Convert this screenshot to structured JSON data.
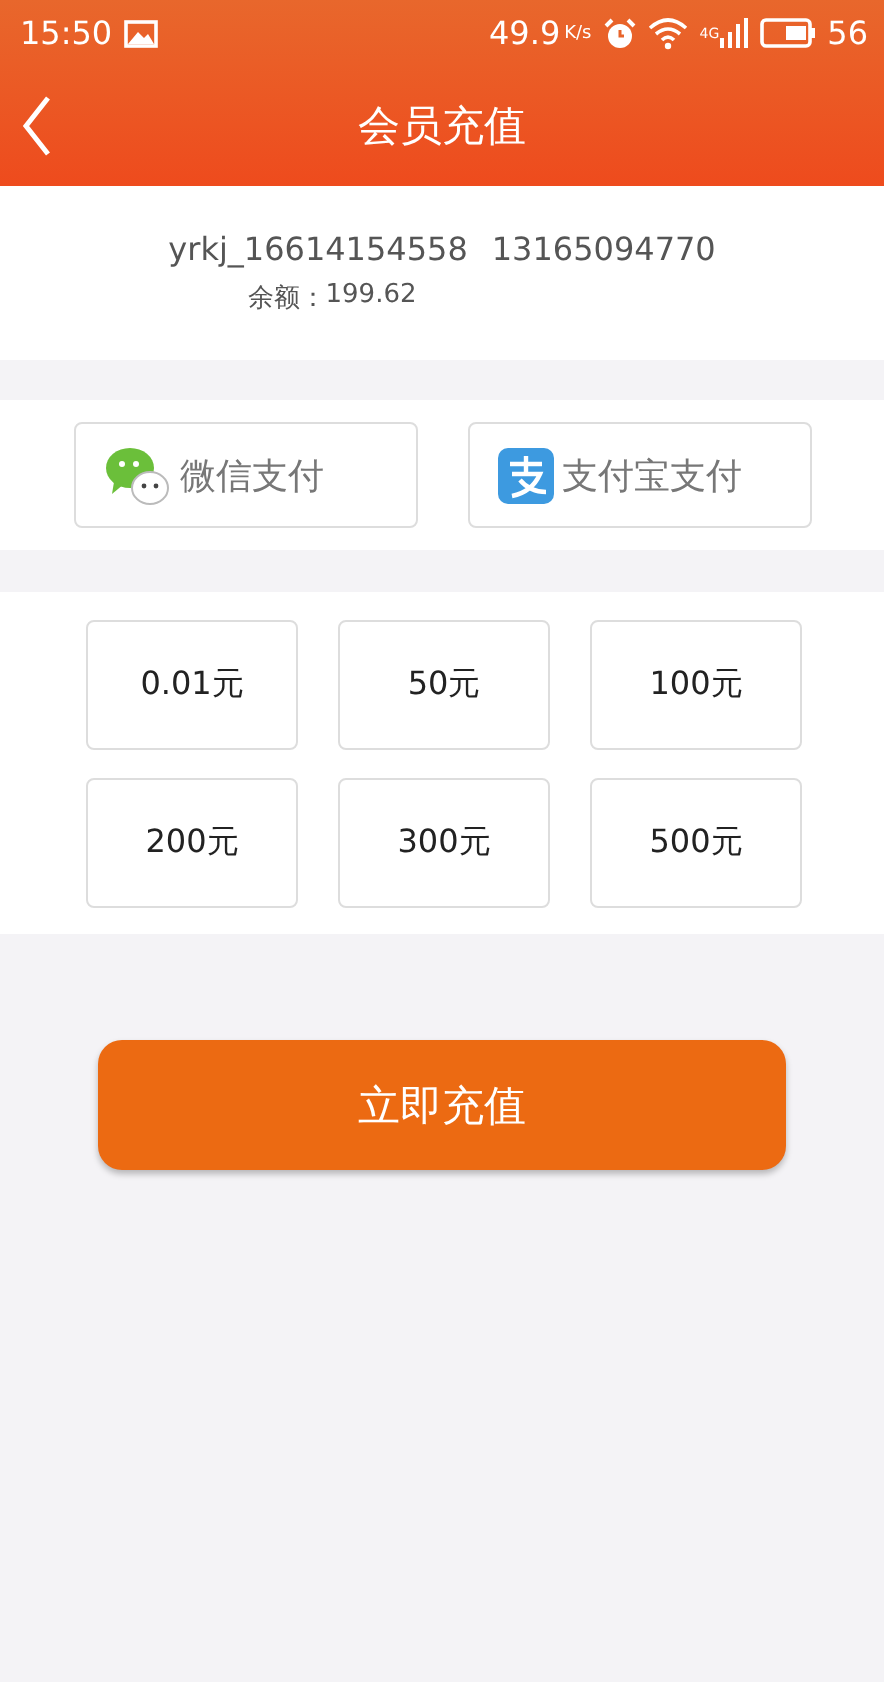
{
  "status_bar": {
    "time": "15:50",
    "speed": "49.9",
    "speed_unit": "K/s",
    "network": "4G",
    "battery": "56"
  },
  "header": {
    "title": "会员充值"
  },
  "account": {
    "username": "yrkj_16614154558",
    "phone": "13165094770",
    "balance_label": "余额：",
    "balance": "199.62"
  },
  "payment_methods": [
    {
      "kind": "wechat",
      "label": "微信支付"
    },
    {
      "kind": "alipay",
      "label": "支付宝支付"
    }
  ],
  "amounts": [
    "0.01元",
    "50元",
    "100元",
    "200元",
    "300元",
    "500元"
  ],
  "submit": "立即充值"
}
